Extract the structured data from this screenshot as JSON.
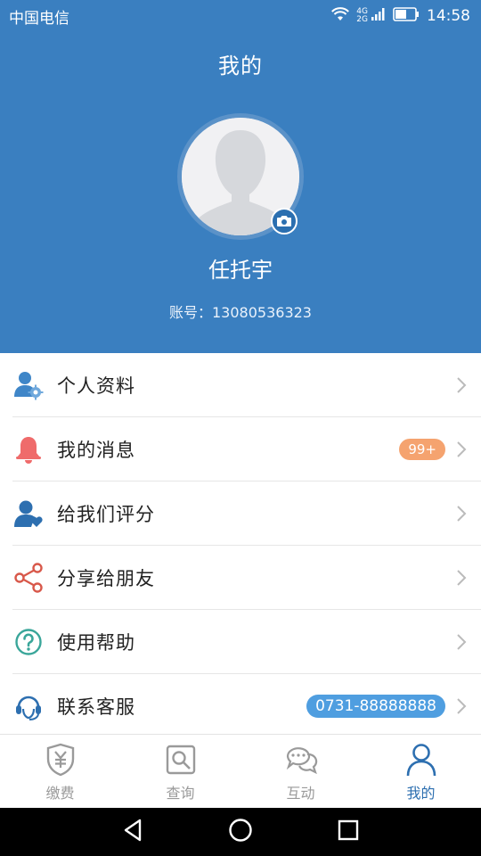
{
  "status": {
    "carrier": "中国电信",
    "net_top": "4G",
    "net_bottom": "2G",
    "time": "14:58"
  },
  "header": {
    "title": "我的",
    "name": "任托宇",
    "account": "账号：13080536323"
  },
  "menu": [
    {
      "label": "个人资料",
      "icon": "user-settings-icon"
    },
    {
      "label": "我的消息",
      "icon": "bell-icon",
      "badge": "99+"
    },
    {
      "label": "给我们评分",
      "icon": "user-heart-icon"
    },
    {
      "label": "分享给朋友",
      "icon": "share-icon"
    },
    {
      "label": "使用帮助",
      "icon": "help-icon"
    },
    {
      "label": "联系客服",
      "icon": "customer-service-icon",
      "badge": "0731-88888888"
    }
  ],
  "tabs": [
    {
      "label": "缴费",
      "icon": "payment-shield-icon"
    },
    {
      "label": "查询",
      "icon": "search-icon"
    },
    {
      "label": "互动",
      "icon": "chat-icon"
    },
    {
      "label": "我的",
      "icon": "user-icon",
      "active": true
    }
  ],
  "colors": {
    "primary": "#3a7fc0",
    "active_tab": "#2d6fb0",
    "badge_orange": "#f5a36f",
    "badge_blue": "#4f9ee0"
  }
}
